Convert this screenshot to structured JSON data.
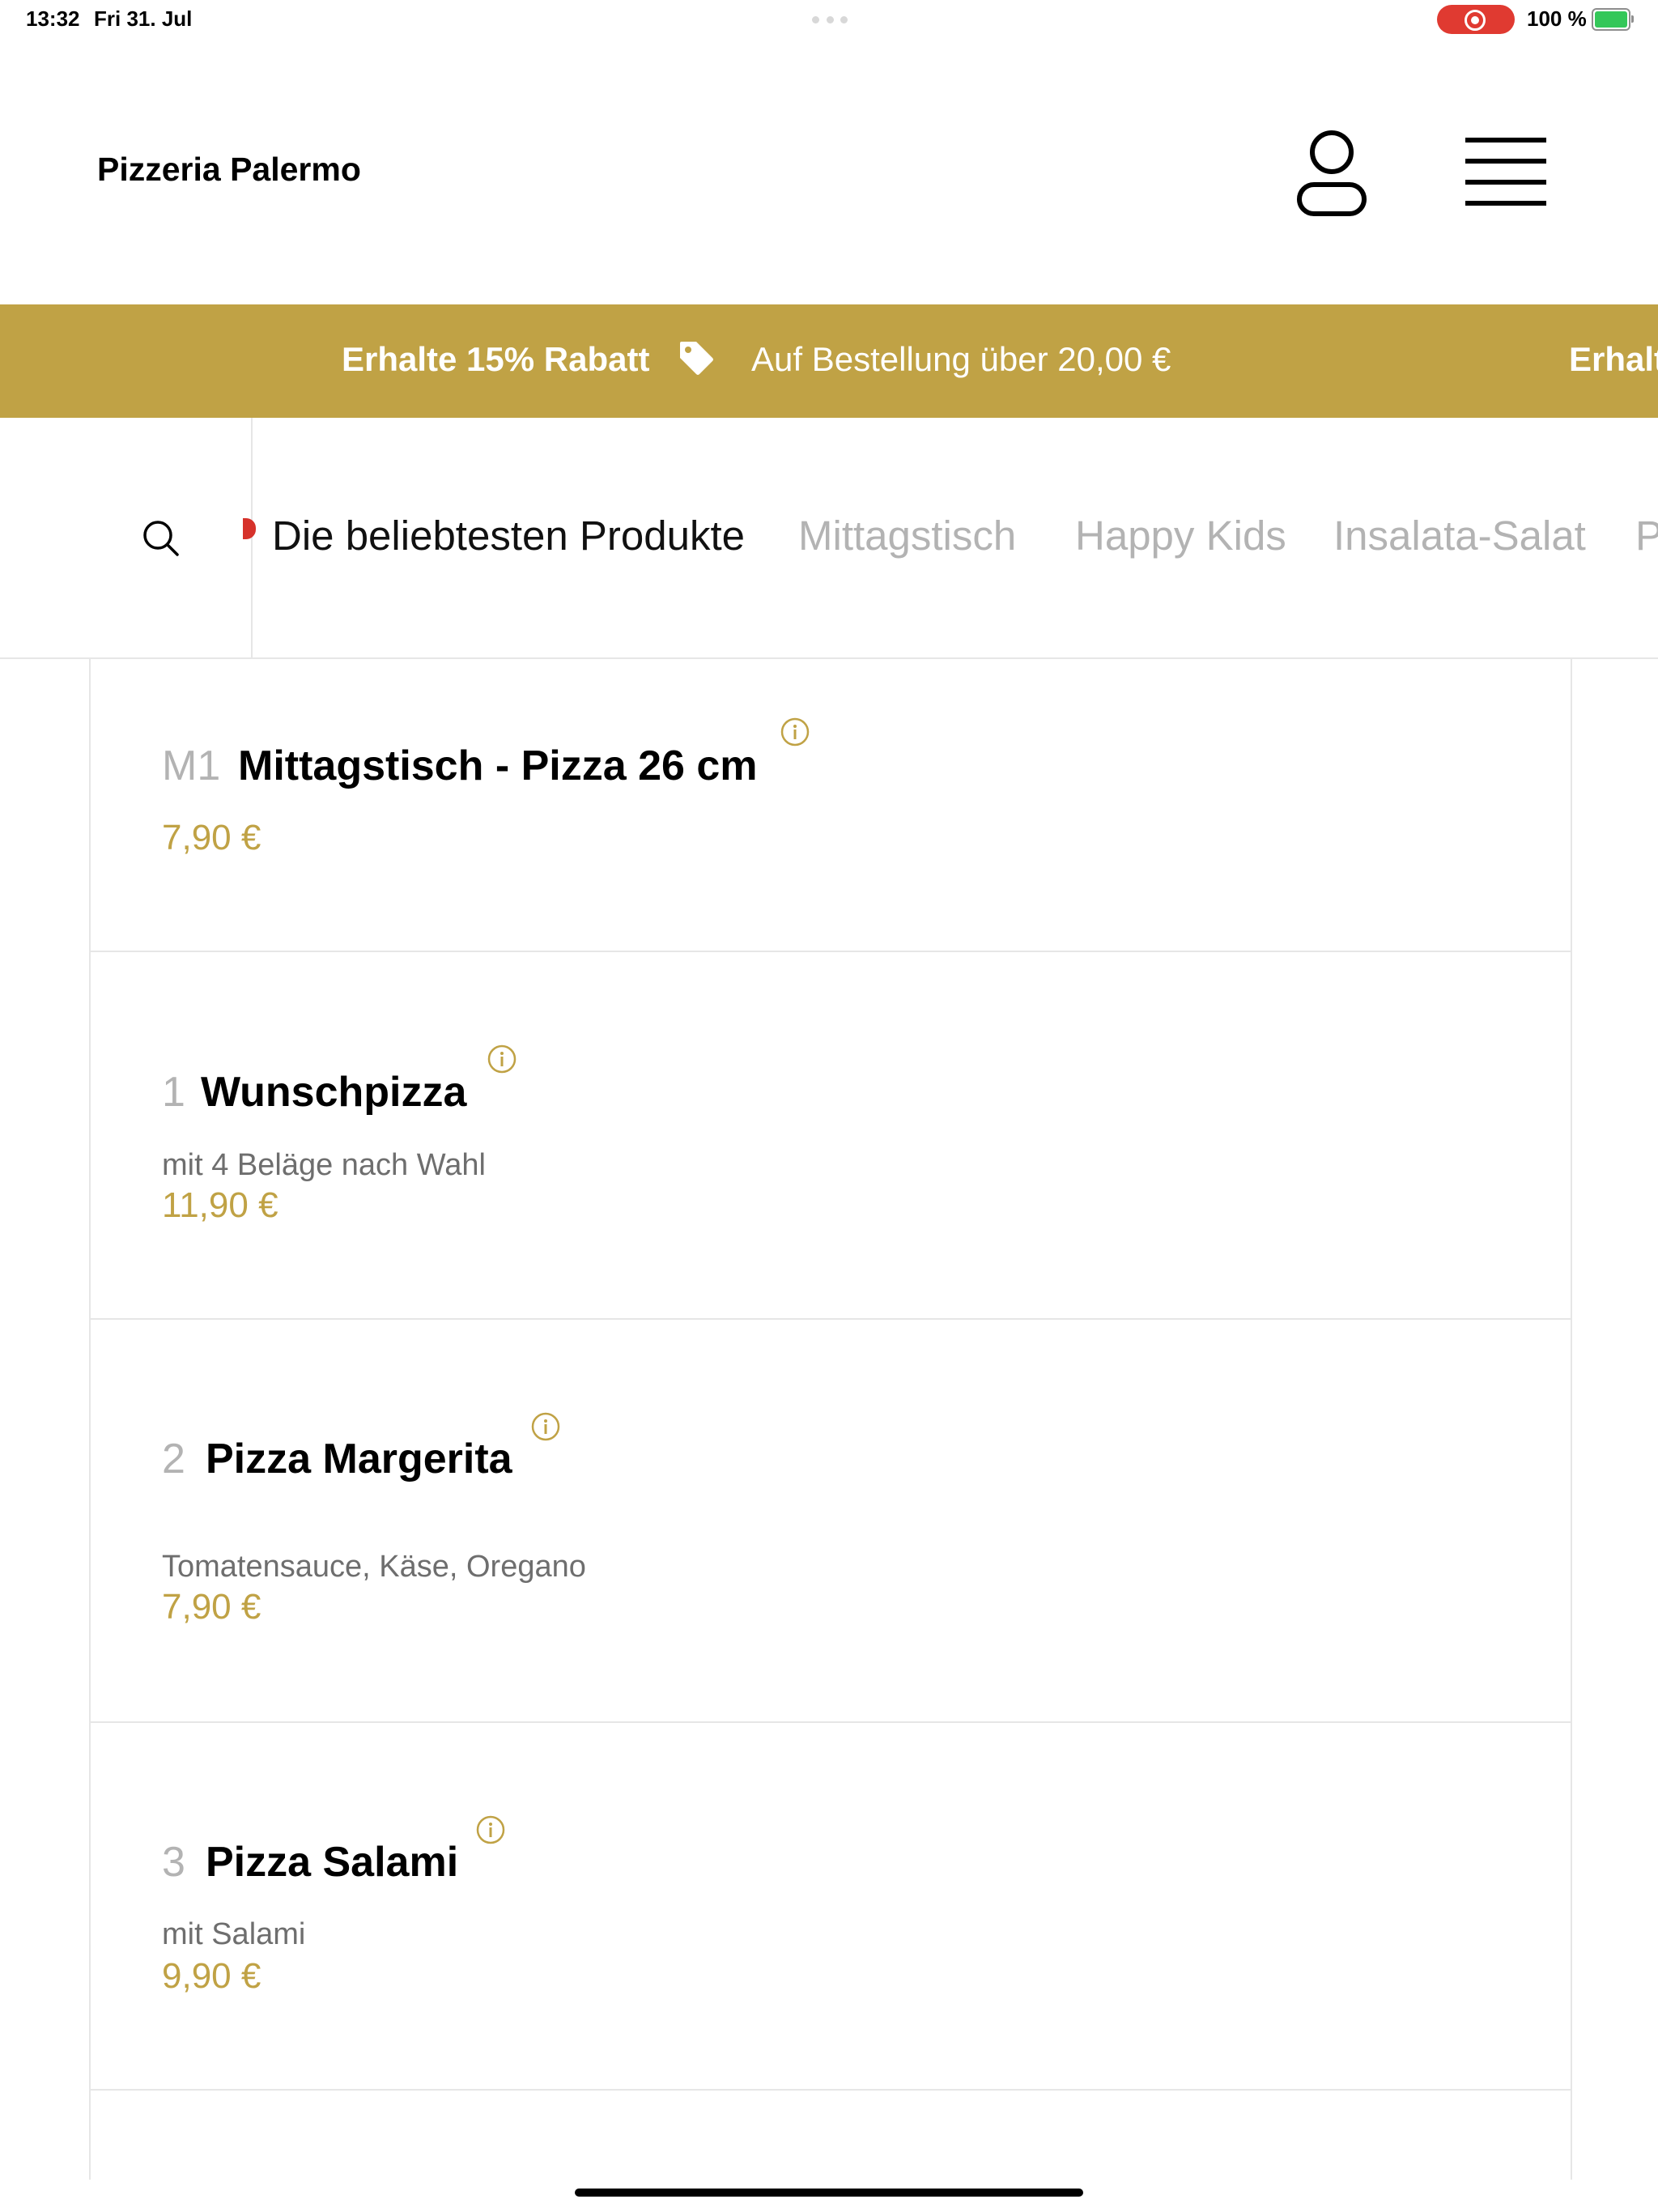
{
  "status_bar": {
    "time": "13:32",
    "date": "Fri 31. Jul",
    "battery": "100 %"
  },
  "header": {
    "brand": "Pizzeria Palermo"
  },
  "promo": {
    "bold": "Erhalte 15% Rabatt",
    "text": "Auf Bestellung über 20,00 €",
    "bold_repeat": "Erhalt"
  },
  "categories": [
    {
      "label": "Die beliebtesten Produkte",
      "active": true
    },
    {
      "label": "Mittagstisch",
      "active": false
    },
    {
      "label": "Happy Kids",
      "active": false
    },
    {
      "label": "Insalata-Salat",
      "active": false
    },
    {
      "label": "P",
      "active": false
    }
  ],
  "products": [
    {
      "number": "M1",
      "name": "Mittagstisch - Pizza 26 cm",
      "description": "",
      "price": "7,90 €"
    },
    {
      "number": "1",
      "name": "Wunschpizza",
      "description": "mit 4 Beläge nach Wahl",
      "price": "11,90 €"
    },
    {
      "number": "2",
      "name": "Pizza Margerita",
      "description": "Tomatensauce, Käse, Oregano",
      "price": "7,90 €"
    },
    {
      "number": "3",
      "name": "Pizza Salami",
      "description": "mit Salami",
      "price": "9,90 €"
    }
  ],
  "colors": {
    "accent": "#c0a245",
    "muted": "#b3b3b3",
    "recording": "#e03a31"
  },
  "icons": [
    "user-icon",
    "menu-icon",
    "tag-icon",
    "search-icon",
    "info-icon"
  ]
}
